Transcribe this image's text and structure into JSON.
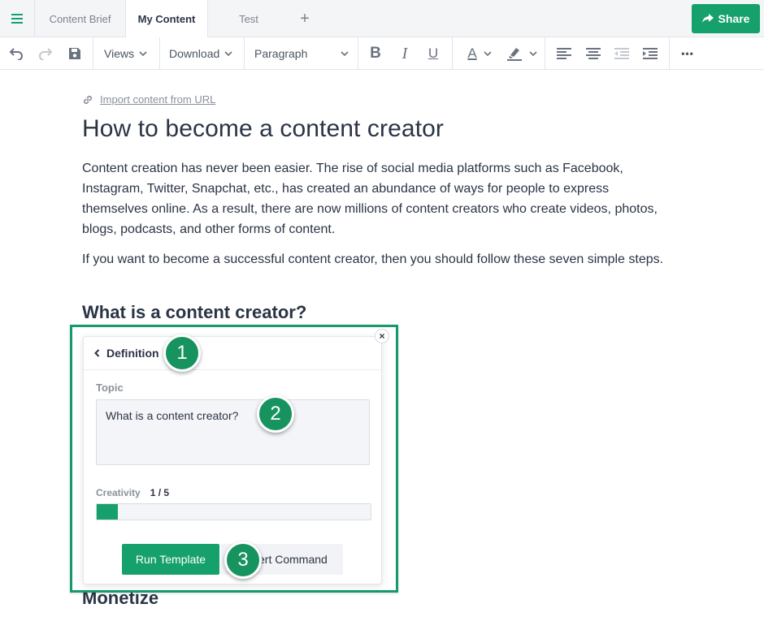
{
  "tabs": {
    "items": [
      "Content Brief",
      "My Content",
      "Test"
    ],
    "add": "+",
    "share_label": "Share"
  },
  "toolbar": {
    "views_label": "Views",
    "download_label": "Download",
    "paragraph_label": "Paragraph",
    "bold": "B",
    "italic": "I",
    "underline": "U",
    "text_color": "A",
    "more": "•••"
  },
  "document": {
    "import_link": "Import content from URL",
    "title": "How to become a content creator",
    "paragraph1": "Content creation has never been easier. The rise of social media platforms such as Facebook, Instagram, Twitter, Snapchat, etc., has created an abundance of ways for people to express themselves online. As a result, there are now millions of content creators who create videos, photos, blogs, podcasts, and other forms of content.",
    "paragraph2": "If you want to become a successful content creator, then you should follow these seven simple steps.",
    "heading1": "What is a content creator?",
    "heading2": "Monetize"
  },
  "panel": {
    "header": "Definition",
    "topic_label": "Topic",
    "topic_value": "What is a content creator?",
    "creativity_label": "Creativity",
    "creativity_value": "1 / 5",
    "creativity_level": 1,
    "creativity_max": 5,
    "run_label": "Run Template",
    "insert_label": "ert Command",
    "close": "×"
  },
  "badges": [
    "1",
    "2",
    "3"
  ],
  "colors": {
    "accent": "#16a06b",
    "highlight": "#179a6a",
    "text": "#2b3445"
  }
}
